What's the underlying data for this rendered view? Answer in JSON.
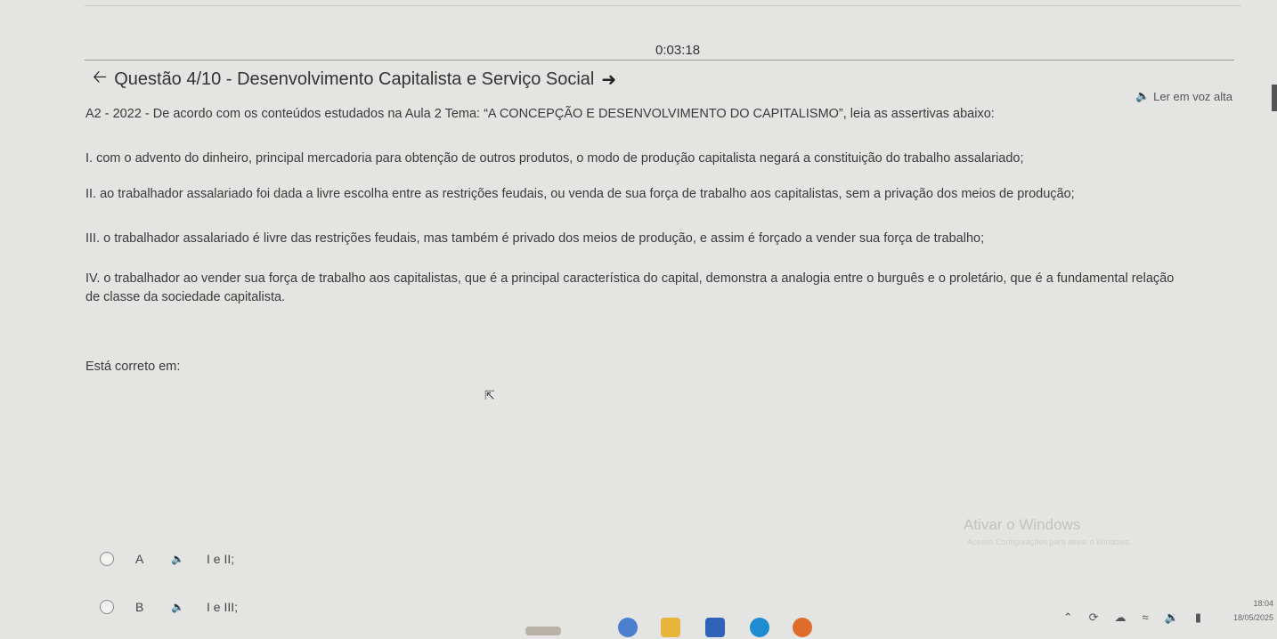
{
  "timer": "0:03:18",
  "question": {
    "title": "Questão 4/10 - Desenvolvimento Capitalista e Serviço Social",
    "read_aloud": "Ler em voz alta",
    "statement": "A2 - 2022 - De acordo com os conteúdos estudados na Aula 2 Tema: “A CONCEPÇÃO E DESENVOLVIMENTO DO CAPITALISMO”, leia as assertivas abaixo:",
    "assertions": [
      "I. com o advento do dinheiro, principal mercadoria para obtenção de outros produtos, o modo de produção capitalista negará a constituição do trabalho assalariado;",
      "II. ao trabalhador assalariado foi dada a livre escolha entre as restrições feudais, ou venda de sua força de trabalho aos capitalistas, sem a privação dos meios de produção;",
      "III. o trabalhador assalariado é livre das restrições feudais, mas também é privado dos meios de produção, e assim é forçado a vender sua força de trabalho;",
      "IV. o trabalhador ao vender sua força de trabalho aos capitalistas, que é a principal característica do capital, demonstra a analogia entre o burguês e o proletário, que é a fundamental relação de classe da sociedade capitalista."
    ],
    "prompt": "Está correto em:",
    "options": [
      {
        "letter": "A",
        "text": "I e II;"
      },
      {
        "letter": "B",
        "text": "I e III;"
      }
    ]
  },
  "watermark": {
    "title": "Ativar o Windows",
    "subtitle": "Acesse Configurações para ativar o Windows."
  },
  "taskbar": {
    "time": "18:04",
    "date": "18/05/2025"
  }
}
